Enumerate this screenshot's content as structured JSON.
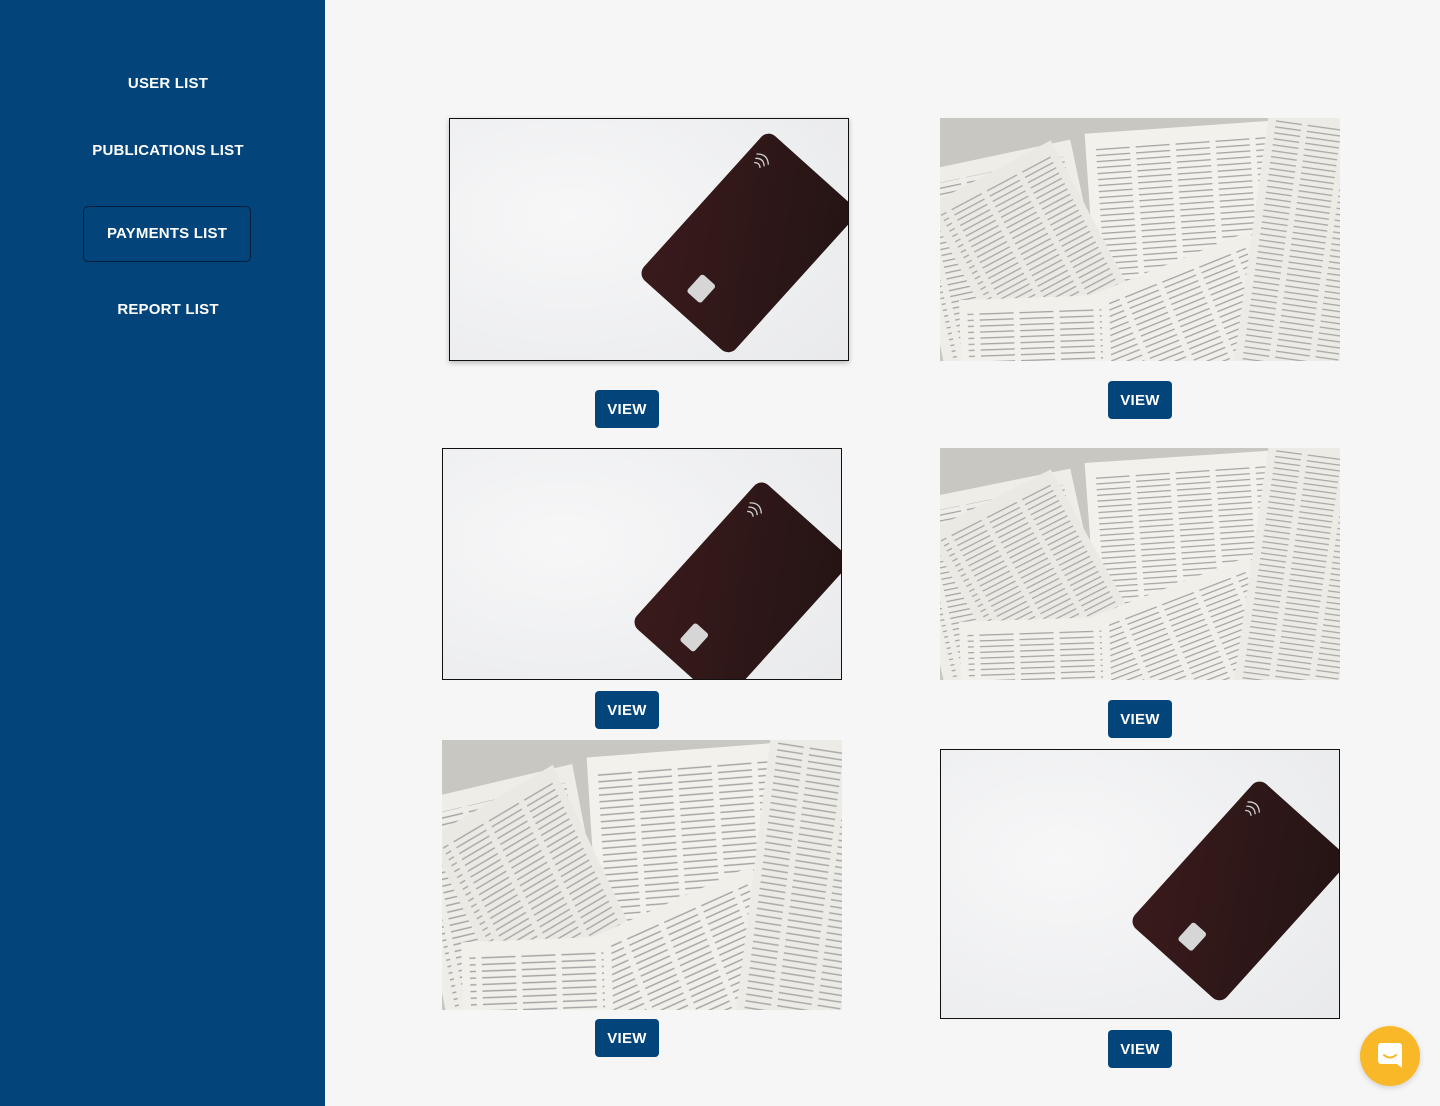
{
  "sidebar": {
    "items": [
      {
        "label": "USER LIST",
        "active": false
      },
      {
        "label": "PUBLICATIONS LIST",
        "active": false
      },
      {
        "label": "PAYMENTS LIST",
        "active": true
      },
      {
        "label": "REPORT LIST",
        "active": false
      }
    ]
  },
  "cards": [
    {
      "image": "credit-card-photo",
      "button_label": "VIEW"
    },
    {
      "image": "book-pages-photo",
      "button_label": "VIEW"
    },
    {
      "image": "credit-card-photo",
      "button_label": "VIEW"
    },
    {
      "image": "book-pages-photo",
      "button_label": "VIEW"
    },
    {
      "image": "book-pages-photo",
      "button_label": "VIEW"
    },
    {
      "image": "credit-card-photo",
      "button_label": "VIEW"
    }
  ],
  "chat": {
    "icon": "chat-icon"
  },
  "colors": {
    "sidebar": "#03447a",
    "button": "#03447a",
    "chat_launcher": "#f9b827",
    "background": "#f6f6f6"
  }
}
